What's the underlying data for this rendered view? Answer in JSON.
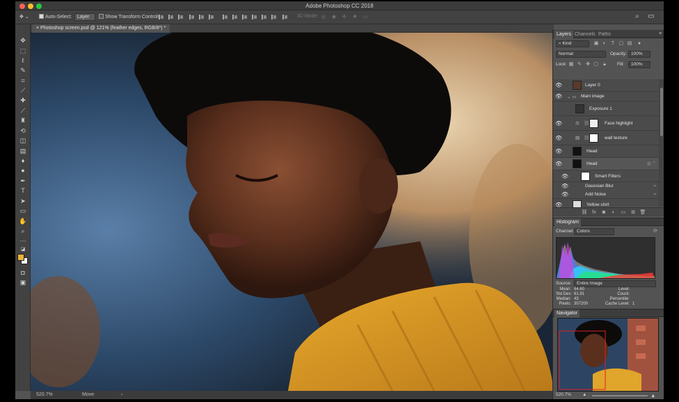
{
  "app": {
    "title": "Adobe Photoshop CC 2018"
  },
  "options_bar": {
    "auto_select_label": "Auto-Select:",
    "auto_select_value": "Layer",
    "show_transform_label": "Show Transform Controls",
    "mode_3d_label": "3D Mode:"
  },
  "document": {
    "tab_title": "Photoshop screen.psd @ 121% (feather edges, RGB/8*) *"
  },
  "status": {
    "zoom": "520.7%",
    "tool": "Move"
  },
  "panels": {
    "tabs": [
      "Layers",
      "Channels",
      "Paths"
    ],
    "kind_label": "Kind",
    "blend_mode": "Normal",
    "opacity_label": "Opacity:",
    "opacity_value": "100%",
    "lock_label": "Lock:",
    "fill_label": "Fill:",
    "fill_value": "100%",
    "layers": [
      {
        "name": "Layer 0",
        "visible": true,
        "type": "image"
      },
      {
        "name": "Main image",
        "visible": true,
        "type": "group"
      },
      {
        "name": "Exposure 1",
        "visible": false,
        "type": "adjustment"
      },
      {
        "name": "Face highlight",
        "visible": true,
        "type": "masked"
      },
      {
        "name": "wall texture",
        "visible": true,
        "type": "masked"
      },
      {
        "name": "Head",
        "visible": true,
        "type": "image"
      },
      {
        "name": "Head",
        "visible": true,
        "type": "smart-object"
      },
      {
        "name": "Smart Filters",
        "visible": true,
        "type": "smart-filters"
      },
      {
        "name": "Gaussian Blur",
        "visible": true,
        "type": "filter"
      },
      {
        "name": "Add Noise",
        "visible": true,
        "type": "filter"
      },
      {
        "name": "Yellow shirt",
        "visible": true,
        "type": "image"
      }
    ],
    "histogram": {
      "title": "Histogram",
      "channel_label": "Channel:",
      "channel_value": "Colors",
      "source_label": "Source:",
      "source_value": "Entire Image",
      "stats_left": [
        {
          "label": "Mean:",
          "value": "64.60"
        },
        {
          "label": "Std Dev:",
          "value": "61.91"
        },
        {
          "label": "Median:",
          "value": "43"
        },
        {
          "label": "Pixels:",
          "value": "307200"
        }
      ],
      "stats_right": [
        {
          "label": "Level:",
          "value": ""
        },
        {
          "label": "Count:",
          "value": ""
        },
        {
          "label": "Percentile:",
          "value": ""
        },
        {
          "label": "Cache Level:",
          "value": "1"
        }
      ]
    },
    "navigator": {
      "title": "Navigator",
      "zoom": "520.7%"
    }
  },
  "colors": {
    "foreground": "#e8b23a",
    "background": "#ffffff"
  }
}
